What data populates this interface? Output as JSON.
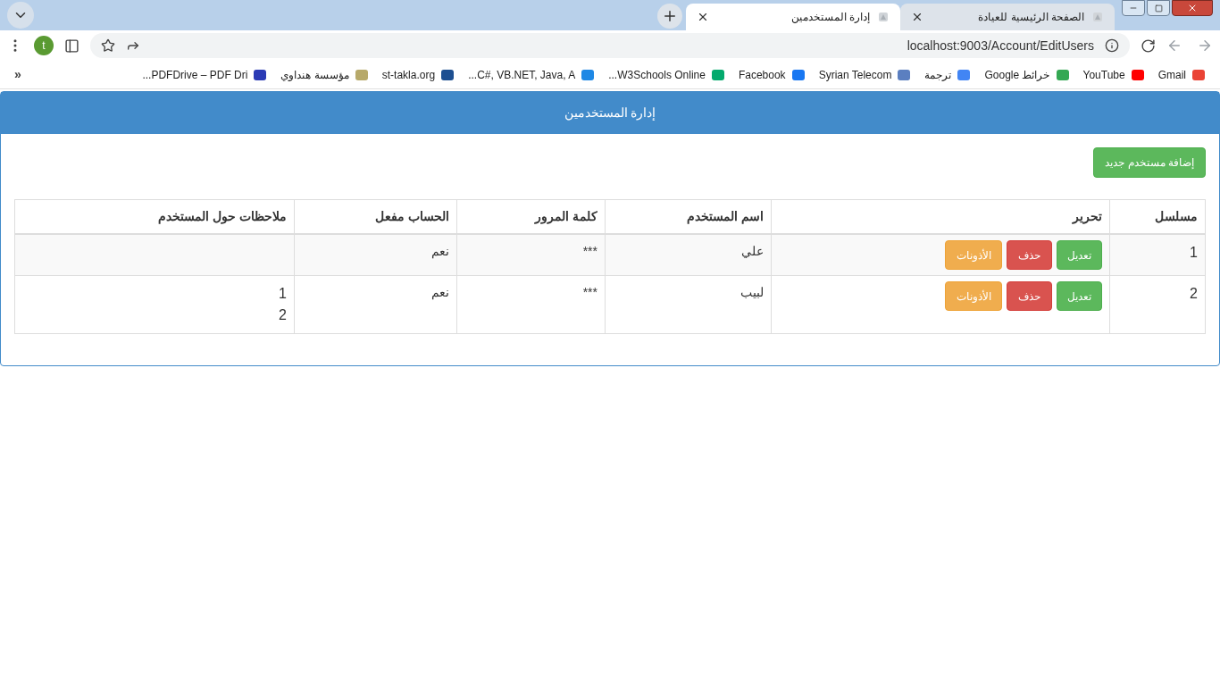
{
  "browser": {
    "tabs": [
      {
        "title": "الصفحة الرئيسية للعيادة",
        "selected": false
      },
      {
        "title": "إدارة المستخدمين",
        "selected": true
      }
    ],
    "profile": "t",
    "url": "localhost:9003/Account/EditUsers",
    "bookmarks": [
      {
        "label": "Gmail"
      },
      {
        "label": "YouTube"
      },
      {
        "label": "خرائط Google"
      },
      {
        "label": "ترجمة"
      },
      {
        "label": "Syrian Telecom"
      },
      {
        "label": "Facebook"
      },
      {
        "label": "W3Schools Online..."
      },
      {
        "label": "C#, VB.NET, Java, A..."
      },
      {
        "label": "st-takla.org"
      },
      {
        "label": "مؤسسة هنداوي"
      },
      {
        "label": "PDFDrive – PDF Dri..."
      }
    ],
    "more_bookmarks": "«"
  },
  "panel": {
    "title": "إدارة المستخدمين",
    "add_button": "إضافة مستخدم جديد"
  },
  "table": {
    "columns": [
      "مسلسل",
      "تحرير",
      "اسم المستخدم",
      "كلمة المرور",
      "الحساب مفعل",
      "ملاحظات حول المستخدم"
    ],
    "rows": [
      {
        "serial": "1",
        "actions": [
          {
            "kind": "edit",
            "label": "تعديل"
          },
          {
            "kind": "delete",
            "label": "حذف"
          },
          {
            "kind": "permissions",
            "label": "الأذونات"
          }
        ],
        "username": "علي",
        "password": "***",
        "active": "نعم",
        "notes": []
      },
      {
        "serial": "2",
        "actions": [
          {
            "kind": "edit",
            "label": "تعديل"
          },
          {
            "kind": "delete",
            "label": "حذف"
          },
          {
            "kind": "permissions",
            "label": "الأذونات"
          }
        ],
        "username": "لبيب",
        "password": "***",
        "active": "نعم",
        "notes": [
          "1",
          "2"
        ]
      }
    ]
  }
}
